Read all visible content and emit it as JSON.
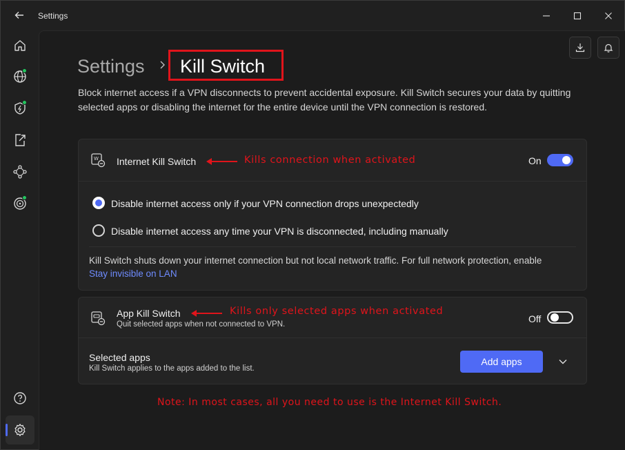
{
  "window": {
    "title": "Settings"
  },
  "sidebar": {
    "items": [
      {
        "name": "home",
        "icon": "home-icon"
      },
      {
        "name": "globe",
        "icon": "globe-icon",
        "status": "active"
      },
      {
        "name": "shield",
        "icon": "shield-icon",
        "status": "active"
      },
      {
        "name": "split-tunnel",
        "icon": "external-link-icon"
      },
      {
        "name": "meshnet",
        "icon": "mesh-network-icon"
      },
      {
        "name": "target",
        "icon": "target-icon",
        "status": "active"
      }
    ],
    "help_icon": "help-icon",
    "settings_icon": "gear-icon"
  },
  "toolbar": {
    "download_icon": "download-icon",
    "bell_icon": "bell-icon"
  },
  "breadcrumb": {
    "root": "Settings",
    "current": "Kill Switch"
  },
  "description": "Block internet access if a VPN disconnects to prevent accidental exposure. Kill Switch secures your data by quitting selected apps or disabling the internet for the entire device until the VPN connection is restored.",
  "internet_kill_switch": {
    "title": "Internet Kill Switch",
    "annotation": "Kills connection when activated",
    "state_label": "On",
    "enabled": true,
    "options": [
      {
        "label": "Disable internet access only if your VPN connection drops unexpectedly",
        "selected": true
      },
      {
        "label": "Disable internet access any time your VPN is disconnected, including manually",
        "selected": false
      }
    ],
    "note": "Kill Switch shuts down your internet connection but not local network traffic. For full network protection, enable",
    "note_link": "Stay invisible on LAN"
  },
  "app_kill_switch": {
    "title": "App Kill Switch",
    "subtitle": "Quit selected apps when not connected to VPN.",
    "annotation": "Kills only selected apps when activated",
    "state_label": "Off",
    "enabled": false,
    "selected_apps_title": "Selected apps",
    "selected_apps_subtitle": "Kill Switch applies to the apps added to the list.",
    "add_button": "Add apps"
  },
  "footnote": "Note: In most cases, all you need to use is the Internet Kill Switch.",
  "colors": {
    "accent": "#4f6af5",
    "annotation_red": "#e0141b",
    "status_green": "#22c55e"
  }
}
